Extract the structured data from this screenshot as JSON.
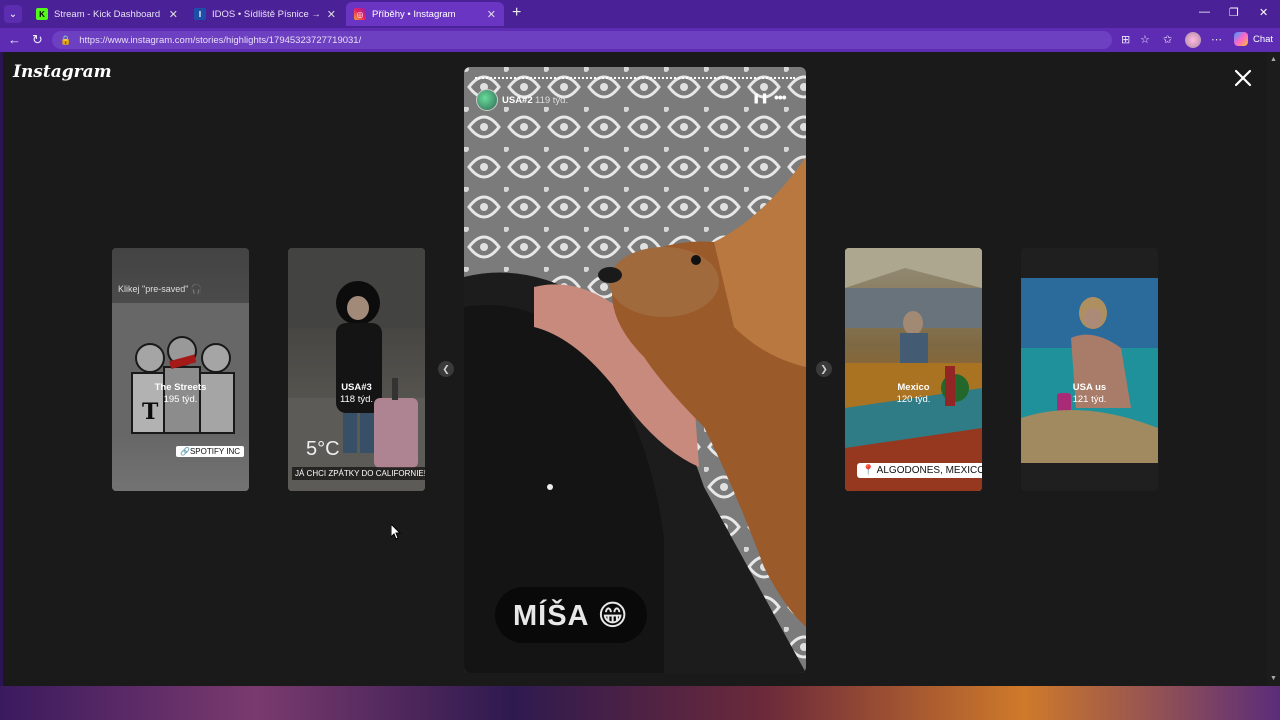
{
  "browser": {
    "tabs": [
      {
        "title": "Stream - Kick Dashboard",
        "favicon": "kick-icon",
        "active": false
      },
      {
        "title": "IDOS • Sídliště Písnice → Zličín • V",
        "favicon": "idos-icon",
        "active": false
      },
      {
        "title": "Příběhy • Instagram",
        "favicon": "instagram-icon",
        "active": true
      }
    ],
    "url": "https://www.instagram.com/stories/highlights/17945323727719031/",
    "chat_label": "Chat"
  },
  "instagram": {
    "logo_text": "Instagram",
    "story": {
      "username": "USA#2",
      "time": "119 týd.",
      "caption": "MÍŠA 😁"
    },
    "side_cards": [
      {
        "name": "The Streets",
        "age": "195 týd.",
        "top_text": "Klikej \"pre-saved\" 🎧",
        "sticker": "🔗SPOTIFY INC"
      },
      {
        "name": "USA#3",
        "age": "118 týd.",
        "temp": "5°C",
        "sticker": "JÁ CHCI ZPÁTKY DO CALIFORNIE!!!"
      },
      {
        "name": "Mexico",
        "age": "120 týd.",
        "sticker": "📍 ALGODONES, MEXICO"
      },
      {
        "name": "USA us",
        "age": "121 týd."
      }
    ]
  },
  "colors": {
    "accent": "#6b35c4",
    "page_bg": "#1a1a1a"
  }
}
